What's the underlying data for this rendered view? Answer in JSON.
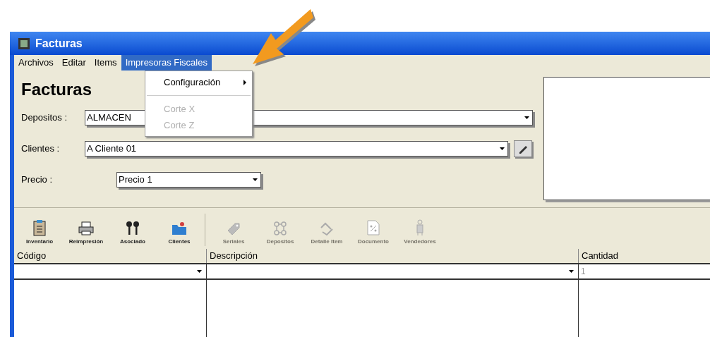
{
  "window": {
    "title": "Facturas"
  },
  "menu_bar": [
    {
      "label": "Archivos",
      "selected": false
    },
    {
      "label": "Editar",
      "selected": false
    },
    {
      "label": "Items",
      "selected": false
    },
    {
      "label": "Impresoras Fiscales",
      "selected": true
    }
  ],
  "open_menu": [
    {
      "kind": "item",
      "label": "Configuración",
      "disabled": false,
      "submenu": true
    },
    {
      "kind": "separator"
    },
    {
      "kind": "item",
      "label": "Corte X",
      "disabled": true,
      "submenu": false
    },
    {
      "kind": "item",
      "label": "Corte Z",
      "disabled": true,
      "submenu": false
    }
  ],
  "heading": "Facturas",
  "fields": [
    {
      "label": "Depositos :",
      "value": "ALMACEN",
      "kind": "wide",
      "lookup_button": false
    },
    {
      "label": "Clientes :",
      "value": "A Cliente 01",
      "kind": "wide",
      "lookup_button": true
    },
    {
      "label": "Precio :",
      "value": "Precio 1",
      "kind": "short",
      "lookup_button": false
    }
  ],
  "toolbar": [
    {
      "label": "Inventario",
      "disabled": false
    },
    {
      "label": "Reimpresión",
      "disabled": false
    },
    {
      "label": "Asociado",
      "disabled": false
    },
    {
      "label": "Clientes",
      "disabled": false
    },
    {
      "label": "Seriales",
      "disabled": true
    },
    {
      "label": "Depositos",
      "disabled": true
    },
    {
      "label": "Detalle Item",
      "disabled": true
    },
    {
      "label": "Documento",
      "disabled": true
    },
    {
      "label": "Vendedores",
      "disabled": true
    }
  ],
  "grid": {
    "columns": [
      "Código",
      "Descripción",
      "Cantidad"
    ],
    "editor_row": {
      "cantidad": "1"
    }
  },
  "annotation": {
    "arrow": true
  }
}
